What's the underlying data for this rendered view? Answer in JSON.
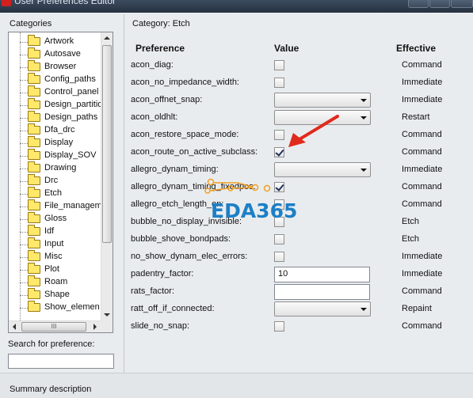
{
  "window": {
    "title": "User Preferences Editor"
  },
  "left_panel": {
    "categories_label": "Categories",
    "items": [
      {
        "label": "Artwork"
      },
      {
        "label": "Autosave"
      },
      {
        "label": "Browser"
      },
      {
        "label": "Config_paths"
      },
      {
        "label": "Control_panel"
      },
      {
        "label": "Design_partitio"
      },
      {
        "label": "Design_paths"
      },
      {
        "label": "Dfa_drc"
      },
      {
        "label": "Display"
      },
      {
        "label": "Display_SOV"
      },
      {
        "label": "Drawing"
      },
      {
        "label": "Drc"
      },
      {
        "label": "Etch"
      },
      {
        "label": "File_managem"
      },
      {
        "label": "Gloss"
      },
      {
        "label": "Idf"
      },
      {
        "label": "Input"
      },
      {
        "label": "Misc"
      },
      {
        "label": "Plot"
      },
      {
        "label": "Roam"
      },
      {
        "label": "Shape"
      },
      {
        "label": "Show_elemen"
      }
    ],
    "hscroll_grip": "III",
    "search_label": "Search for preference:",
    "search_value": ""
  },
  "main": {
    "category_title": "Category:  Etch",
    "columns": {
      "preference": "Preference",
      "value": "Value",
      "effective": "Effective"
    },
    "rows": [
      {
        "name": "acon_diag:",
        "control": "checkbox",
        "checked": false,
        "effective": "Command"
      },
      {
        "name": "acon_no_impedance_width:",
        "control": "checkbox",
        "checked": false,
        "effective": "Immediate"
      },
      {
        "name": "acon_offnet_snap:",
        "control": "dropdown",
        "value": "",
        "effective": "Immediate"
      },
      {
        "name": "acon_oldhlt:",
        "control": "dropdown",
        "value": "",
        "effective": "Restart"
      },
      {
        "name": "acon_restore_space_mode:",
        "control": "checkbox",
        "checked": false,
        "effective": "Command"
      },
      {
        "name": "acon_route_on_active_subclass:",
        "control": "checkbox",
        "checked": true,
        "effective": "Command"
      },
      {
        "name": "allegro_dynam_timing:",
        "control": "dropdown",
        "value": "",
        "effective": "Immediate"
      },
      {
        "name": "allegro_dynam_timing_fixedpos:",
        "control": "checkbox",
        "checked": true,
        "effective": "Command"
      },
      {
        "name": "allegro_etch_length_on:",
        "control": "checkbox",
        "checked": false,
        "effective": "Command"
      },
      {
        "name": "bubble_no_display_invisible:",
        "control": "checkbox",
        "checked": false,
        "effective": "Etch"
      },
      {
        "name": "bubble_shove_bondpads:",
        "control": "checkbox",
        "checked": false,
        "effective": "Etch"
      },
      {
        "name": "no_show_dynam_elec_errors:",
        "control": "checkbox",
        "checked": false,
        "effective": "Immediate"
      },
      {
        "name": "padentry_factor:",
        "control": "text",
        "value": "10",
        "effective": "Immediate"
      },
      {
        "name": "rats_factor:",
        "control": "text",
        "value": "",
        "effective": "Command"
      },
      {
        "name": "ratt_off_if_connected:",
        "control": "dropdown",
        "value": "",
        "effective": "Repaint"
      },
      {
        "name": "slide_no_snap:",
        "control": "checkbox",
        "checked": false,
        "effective": "Command"
      }
    ]
  },
  "summary": {
    "label": "Summary description"
  },
  "overlay": {
    "watermark_text": "EDA365",
    "arrow_color": "#e02a1c",
    "watermark_color": "#1d7fc6"
  }
}
